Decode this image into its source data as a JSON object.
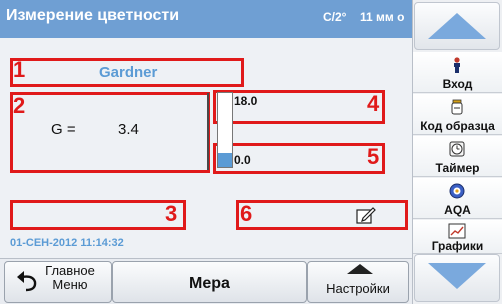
{
  "header": {
    "title": "Измерение цветности",
    "status_temp": "C/2°",
    "status_cuvette": "11 мм о"
  },
  "main": {
    "method_name": "Gardner",
    "result_label": "G =",
    "result_value": "3.4",
    "bar_max": "18.0",
    "bar_min": "0.0",
    "bar_level": 0.19,
    "datetime": "01-СЕН-2012 11:14:32",
    "annotations": [
      "1",
      "2",
      "3",
      "4",
      "5",
      "6"
    ]
  },
  "sidebar": {
    "items": [
      {
        "label": "Вход",
        "icon": "user-icon"
      },
      {
        "label": "Код образца",
        "icon": "sample-bottle-icon"
      },
      {
        "label": "Таймер",
        "icon": "timer-icon"
      },
      {
        "label": "AQA",
        "icon": "aqa-icon"
      },
      {
        "label": "Графики",
        "icon": "chart-icon"
      }
    ]
  },
  "bottom": {
    "home_line1": "Главное",
    "home_line2": "Меню",
    "measure": "Мера",
    "settings": "Настройки"
  },
  "colors": {
    "header_bg": "#6f9fd3",
    "accent_blue": "#5b9bd5",
    "annotation_red": "#e01a1a"
  }
}
